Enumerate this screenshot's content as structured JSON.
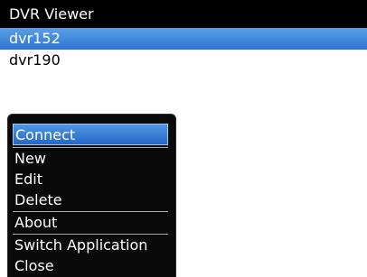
{
  "app": {
    "title": "DVR Viewer"
  },
  "list": {
    "items": [
      "dvr152",
      "dvr190"
    ]
  },
  "menu": {
    "items": [
      "Connect",
      "New",
      "Edit",
      "Delete",
      "About",
      "Switch Application",
      "Close"
    ]
  },
  "colors": {
    "selection": "#2c75d0",
    "menu_background": "#0a0a0a",
    "titlebar": "#000000"
  }
}
